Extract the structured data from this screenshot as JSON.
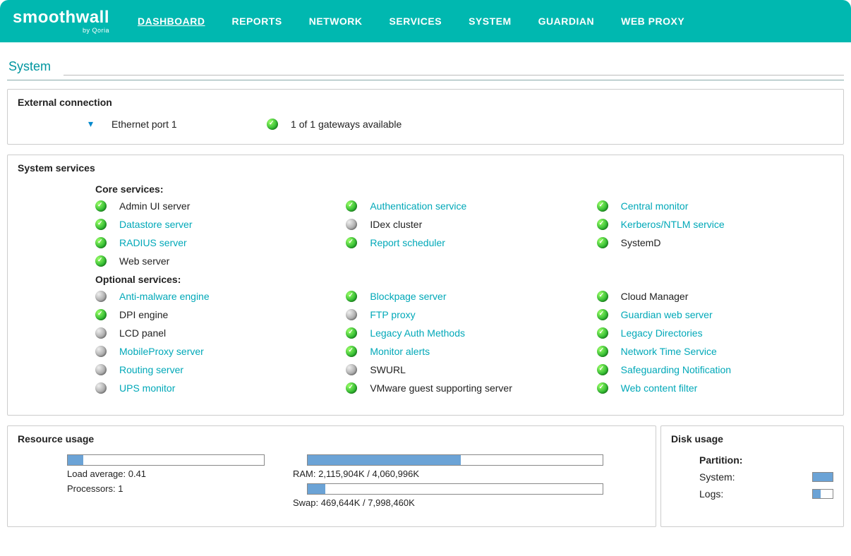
{
  "brand": {
    "name": "smoothwall",
    "sub": "by Qoria"
  },
  "nav": [
    {
      "label": "DASHBOARD",
      "active": true
    },
    {
      "label": "REPORTS"
    },
    {
      "label": "NETWORK"
    },
    {
      "label": "SERVICES"
    },
    {
      "label": "SYSTEM"
    },
    {
      "label": "GUARDIAN"
    },
    {
      "label": "WEB PROXY"
    }
  ],
  "page_title": "System",
  "external_connection": {
    "panel_title": "External connection",
    "interface": "Ethernet port 1",
    "status_text": "1 of 1 gateways available"
  },
  "system_services": {
    "panel_title": "System services",
    "core_title": "Core services:",
    "optional_title": "Optional services:",
    "core": [
      {
        "name": "Admin UI server",
        "status": "green",
        "link": false
      },
      {
        "name": "Authentication service",
        "status": "green",
        "link": true
      },
      {
        "name": "Central monitor",
        "status": "green",
        "link": true
      },
      {
        "name": "Datastore server",
        "status": "green",
        "link": true
      },
      {
        "name": "IDex cluster",
        "status": "gray",
        "link": false
      },
      {
        "name": "Kerberos/NTLM service",
        "status": "green",
        "link": true
      },
      {
        "name": "RADIUS server",
        "status": "green",
        "link": true
      },
      {
        "name": "Report scheduler",
        "status": "green",
        "link": true
      },
      {
        "name": "SystemD",
        "status": "green",
        "link": false
      },
      {
        "name": "Web server",
        "status": "green",
        "link": false
      }
    ],
    "optional": [
      {
        "name": "Anti-malware engine",
        "status": "gray",
        "link": true
      },
      {
        "name": "Blockpage server",
        "status": "green",
        "link": true
      },
      {
        "name": "Cloud Manager",
        "status": "green",
        "link": false
      },
      {
        "name": "DPI engine",
        "status": "green",
        "link": false
      },
      {
        "name": "FTP proxy",
        "status": "gray",
        "link": true
      },
      {
        "name": "Guardian web server",
        "status": "green",
        "link": true
      },
      {
        "name": "LCD panel",
        "status": "gray",
        "link": false
      },
      {
        "name": "Legacy Auth Methods",
        "status": "green",
        "link": true
      },
      {
        "name": "Legacy Directories",
        "status": "green",
        "link": true
      },
      {
        "name": "MobileProxy server",
        "status": "gray",
        "link": true
      },
      {
        "name": "Monitor alerts",
        "status": "green",
        "link": true
      },
      {
        "name": "Network Time Service",
        "status": "green",
        "link": true
      },
      {
        "name": "Routing server",
        "status": "gray",
        "link": true
      },
      {
        "name": "SWURL",
        "status": "gray",
        "link": false
      },
      {
        "name": "Safeguarding Notification",
        "status": "green",
        "link": true
      },
      {
        "name": "UPS monitor",
        "status": "gray",
        "link": true
      },
      {
        "name": "VMware guest supporting server",
        "status": "green",
        "link": false
      },
      {
        "name": "Web content filter",
        "status": "green",
        "link": true
      }
    ]
  },
  "resource_usage": {
    "panel_title": "Resource usage",
    "load_bar_pct": 8,
    "load_text": "Load average: 0.41",
    "proc_text": "Processors: 1",
    "ram_bar_pct": 52,
    "ram_text": "RAM: 2,115,904K / 4,060,996K",
    "swap_bar_pct": 6,
    "swap_text": "Swap: 469,644K / 7,998,460K"
  },
  "disk_usage": {
    "panel_title": "Disk usage",
    "partition_label": "Partition:",
    "rows": [
      {
        "label": "System:",
        "pct": 100
      },
      {
        "label": "Logs:",
        "pct": 40
      }
    ]
  }
}
